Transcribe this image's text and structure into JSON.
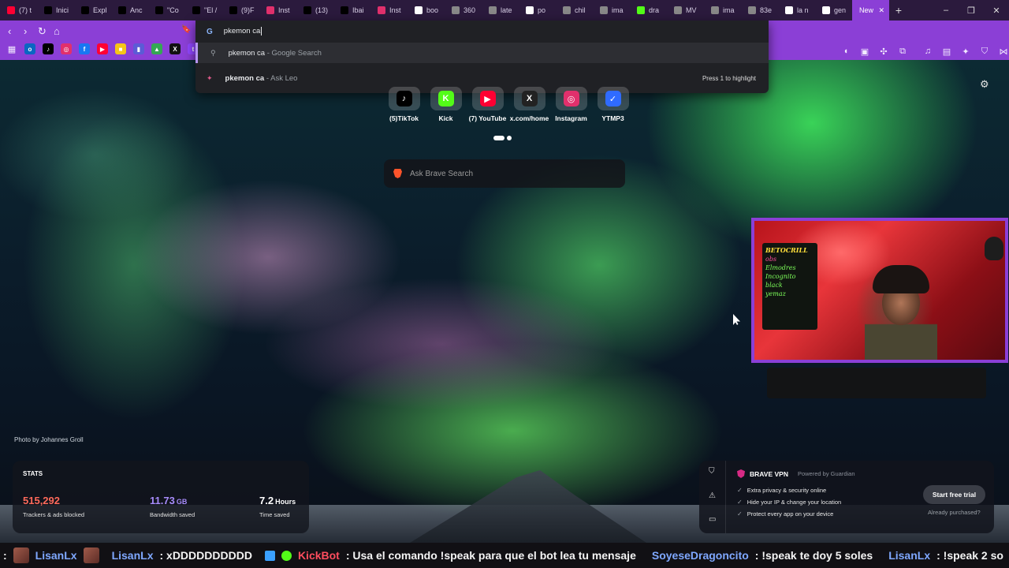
{
  "browser": {
    "tabs": [
      {
        "label": "(7) t",
        "icon": "youtube-icon",
        "color": "#ff0033"
      },
      {
        "label": "Inici",
        "icon": "x-icon",
        "color": "#000000"
      },
      {
        "label": "Expl",
        "icon": "x-icon",
        "color": "#000000"
      },
      {
        "label": "Anc",
        "icon": "x-icon",
        "color": "#000000"
      },
      {
        "label": "\"Co",
        "icon": "x-icon",
        "color": "#000000"
      },
      {
        "label": "\"El /",
        "icon": "x-icon",
        "color": "#000000"
      },
      {
        "label": "(9)F",
        "icon": "tiktok-icon",
        "color": "#000000"
      },
      {
        "label": "Inst",
        "icon": "instagram-icon",
        "color": "#e1306c"
      },
      {
        "label": "(13)",
        "icon": "tiktok-icon",
        "color": "#000000"
      },
      {
        "label": "Ibai",
        "icon": "tiktok-icon",
        "color": "#000000"
      },
      {
        "label": "Inst",
        "icon": "instagram-icon",
        "color": "#e1306c"
      },
      {
        "label": "boo",
        "icon": "google-icon",
        "color": "#ffffff"
      },
      {
        "label": "360",
        "icon": "globe-icon",
        "color": "#888888"
      },
      {
        "label": "late",
        "icon": "globe-icon",
        "color": "#888888"
      },
      {
        "label": "po",
        "icon": "google-icon",
        "color": "#ffffff"
      },
      {
        "label": "chil",
        "icon": "globe-icon",
        "color": "#888888"
      },
      {
        "label": "ima",
        "icon": "globe-icon",
        "color": "#888888"
      },
      {
        "label": "dra",
        "icon": "kick-icon",
        "color": "#53fc18"
      },
      {
        "label": "MV",
        "icon": "globe-icon",
        "color": "#888888"
      },
      {
        "label": "ima",
        "icon": "globe-icon",
        "color": "#888888"
      },
      {
        "label": "83e",
        "icon": "globe-icon",
        "color": "#888888"
      },
      {
        "label": "la n",
        "icon": "google-icon",
        "color": "#ffffff"
      },
      {
        "label": "gen",
        "icon": "google-icon",
        "color": "#ffffff"
      },
      {
        "label": "New",
        "icon": "brave-icon",
        "color": "#8b3fd6",
        "active": true
      }
    ],
    "new_tab_symbol": "+",
    "window_controls": [
      "–",
      "❐",
      "✕"
    ],
    "nav": {
      "back": "‹",
      "forward": "›",
      "reload": "↻",
      "home": "⌂",
      "bookmark": "🔖"
    }
  },
  "omnibox": {
    "engine_icon": "G",
    "query": "pkemon ca",
    "suggestions": [
      {
        "bold": "pkemon ca",
        "source": " - Google Search",
        "icon": "search-icon"
      },
      {
        "bold": "pkemon ca",
        "source": " - Ask Leo",
        "icon": "leo-icon"
      }
    ],
    "hint": "Press 1 to highlight"
  },
  "top_sites": [
    {
      "label": "(5)TikTok",
      "glyph": "♪",
      "color": "#000000"
    },
    {
      "label": "Kick",
      "glyph": "K",
      "color": "#53fc18"
    },
    {
      "label": "(7) YouTube",
      "glyph": "▶",
      "color": "#ff0033"
    },
    {
      "label": "x.com/home",
      "glyph": "X",
      "color": "#222222"
    },
    {
      "label": "Instagram",
      "glyph": "◎",
      "color": "#e1306c"
    },
    {
      "label": "YTMP3",
      "glyph": "✓",
      "color": "#2f6bff"
    }
  ],
  "search": {
    "placeholder": "Ask Brave Search"
  },
  "photo_credit": "Photo by Johannes Groll",
  "stats": {
    "title": "STATS",
    "trackers": {
      "value": "515,292",
      "caption": "Trackers & ads blocked",
      "color": "#ff6a5a"
    },
    "bandwidth": {
      "value": "11.73",
      "unit": "GB",
      "caption": "Bandwidth saved",
      "color": "#a78bfa"
    },
    "time": {
      "value": "7.2",
      "unit": "Hours",
      "caption": "Time saved",
      "color": "#ffffff"
    }
  },
  "vpn": {
    "name": "BRAVE VPN",
    "powered": "Powered by  Guardian",
    "features": [
      "Extra privacy & security online",
      "Hide your IP & change your location",
      "Protect every app on your device"
    ],
    "cta": "Start free trial",
    "purchased": "Already purchased?"
  },
  "webcam": {
    "board_lines": [
      "BETOCRILL",
      "obs",
      "Elmodres",
      "Incognito",
      "black",
      "yemaz"
    ]
  },
  "chat": [
    {
      "user": "LisanLx",
      "msg": ": xDDDDDDDDDD",
      "color": "blue"
    },
    {
      "user": "KickBot",
      "msg": ": Usa el comando !speak para que el bot lea tu mensaje",
      "color": "red"
    },
    {
      "user": "SoyeseDragoncito",
      "msg": ": !speak te doy 5 soles",
      "color": "blue"
    },
    {
      "user": "LisanLx",
      "msg": ": !speak 2 so",
      "color": "blue"
    }
  ],
  "chat_lead": ":"
}
